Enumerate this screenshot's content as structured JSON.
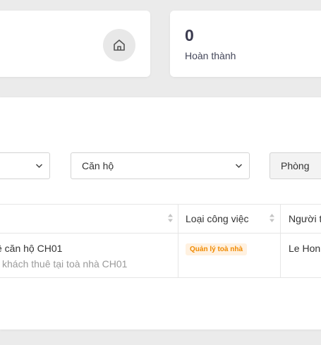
{
  "stats": {
    "left_card": {
      "icon": "home-icon"
    },
    "right_card": {
      "value": "0",
      "label": "Hoàn thành"
    }
  },
  "filters": {
    "first_select": {
      "value": ""
    },
    "apartment_select": {
      "value": "Căn hộ"
    },
    "room_select": {
      "value": "Phòng"
    }
  },
  "table": {
    "columns": [
      {
        "label": ""
      },
      {
        "label": "Loại công việc"
      },
      {
        "label": "Người t"
      }
    ],
    "rows": [
      {
        "title": "ê căn hộ CH01",
        "subtitle": "khách thuê tại toà nhà CH01",
        "job_type": "Quản lý toà nhà",
        "person": "Le Hon"
      }
    ]
  },
  "colors": {
    "background": "#ebebeb",
    "badge_text": "#f08a00",
    "badge_bg": "#fff1e0",
    "stat_value": "#3b3b4f"
  }
}
